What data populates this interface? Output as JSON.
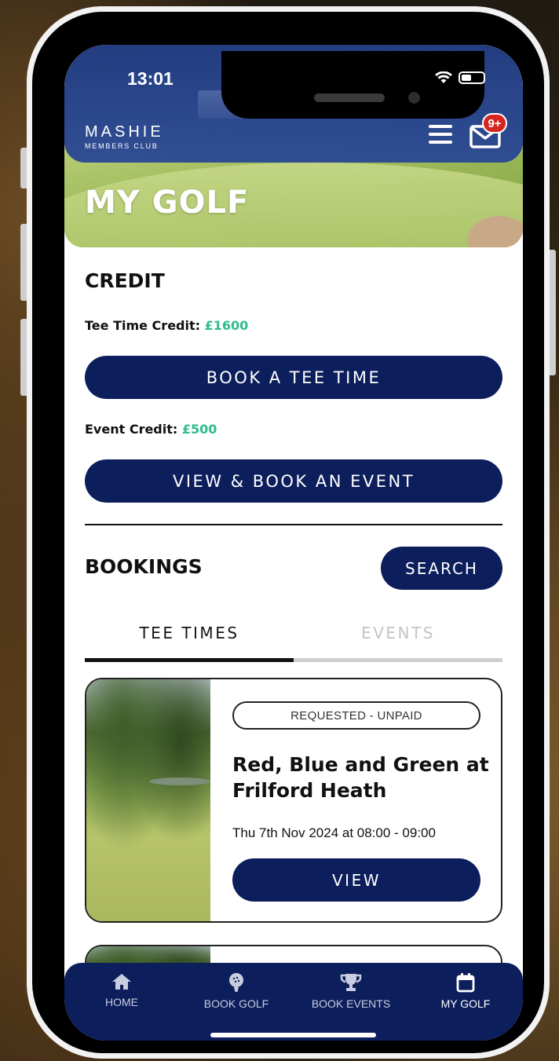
{
  "status_bar": {
    "time": "13:01"
  },
  "header": {
    "logo_main": "MASHIE",
    "logo_sub": "MEMBERS CLUB",
    "notification_badge": "9+",
    "page_title": "MY GOLF"
  },
  "credit": {
    "heading": "CREDIT",
    "tee_time_label": "Tee Time Credit:",
    "tee_time_amount": "£1600",
    "book_tee_time_button": "BOOK A TEE TIME",
    "event_label": "Event Credit:",
    "event_amount": "£500",
    "book_event_button": "VIEW & BOOK AN EVENT"
  },
  "bookings": {
    "heading": "BOOKINGS",
    "search_button": "SEARCH",
    "tabs": [
      "TEE TIMES",
      "EVENTS"
    ],
    "active_tab": "TEE TIMES",
    "cards": [
      {
        "status": "REQUESTED - UNPAID",
        "title": "Red, Blue and Green at Frilford Heath",
        "date": "Thu 7th Nov 2024 at 08:00 - 09:00",
        "button": "VIEW"
      }
    ]
  },
  "bottom_nav": [
    {
      "label": "HOME",
      "icon": "home-icon"
    },
    {
      "label": "BOOK GOLF",
      "icon": "golf-ball-icon"
    },
    {
      "label": "BOOK EVENTS",
      "icon": "trophy-icon"
    },
    {
      "label": "MY GOLF",
      "icon": "calendar-icon",
      "active": true
    }
  ],
  "colors": {
    "navy": "#0c1e5b",
    "header_blue": "#1e3782",
    "credit_green": "#2ebd8a",
    "badge_red": "#d4261f"
  }
}
